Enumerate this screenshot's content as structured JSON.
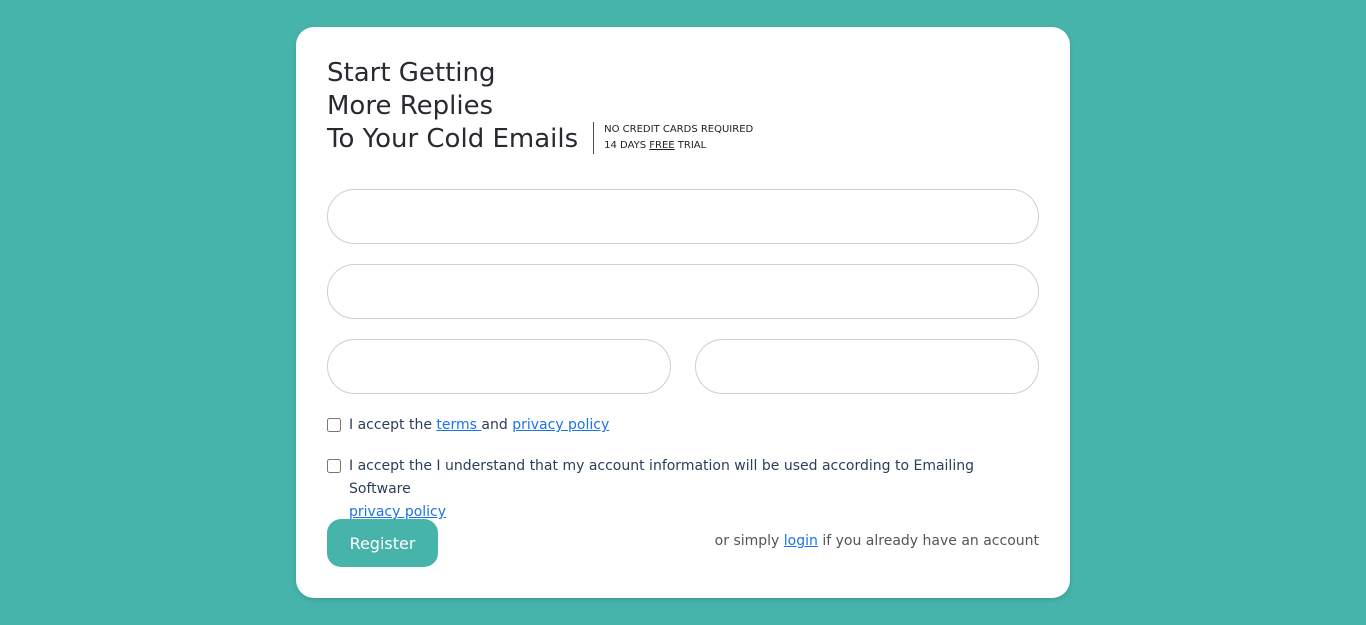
{
  "headline": {
    "line1": "Start Getting",
    "line2": "More Replies",
    "line3": "To Your Cold Emails"
  },
  "side_note": {
    "line1": "NO CREDIT CARDS REQUIRED",
    "line2_prefix": "14 DAYS ",
    "line2_emph": "FREE",
    "line2_suffix": " TRIAL"
  },
  "form": {
    "field1": {
      "value": "",
      "placeholder": ""
    },
    "field2": {
      "value": "",
      "placeholder": ""
    },
    "field3": {
      "value": "",
      "placeholder": ""
    },
    "field4": {
      "value": "",
      "placeholder": ""
    }
  },
  "consent1": {
    "prefix": "I accept the ",
    "terms_link": "terms ",
    "middle": "and ",
    "privacy_link": "privacy policy"
  },
  "consent2": {
    "text": "I accept the I understand that my account information will be used according to Emailing Software",
    "privacy_link": "privacy policy"
  },
  "register_label": "Register",
  "login_note": {
    "prefix": "or simply ",
    "link": "login",
    "suffix": " if you already have an account"
  },
  "colors": {
    "background": "#47b4ab",
    "accent": "#47b4ab",
    "link": "#1a73e8"
  }
}
